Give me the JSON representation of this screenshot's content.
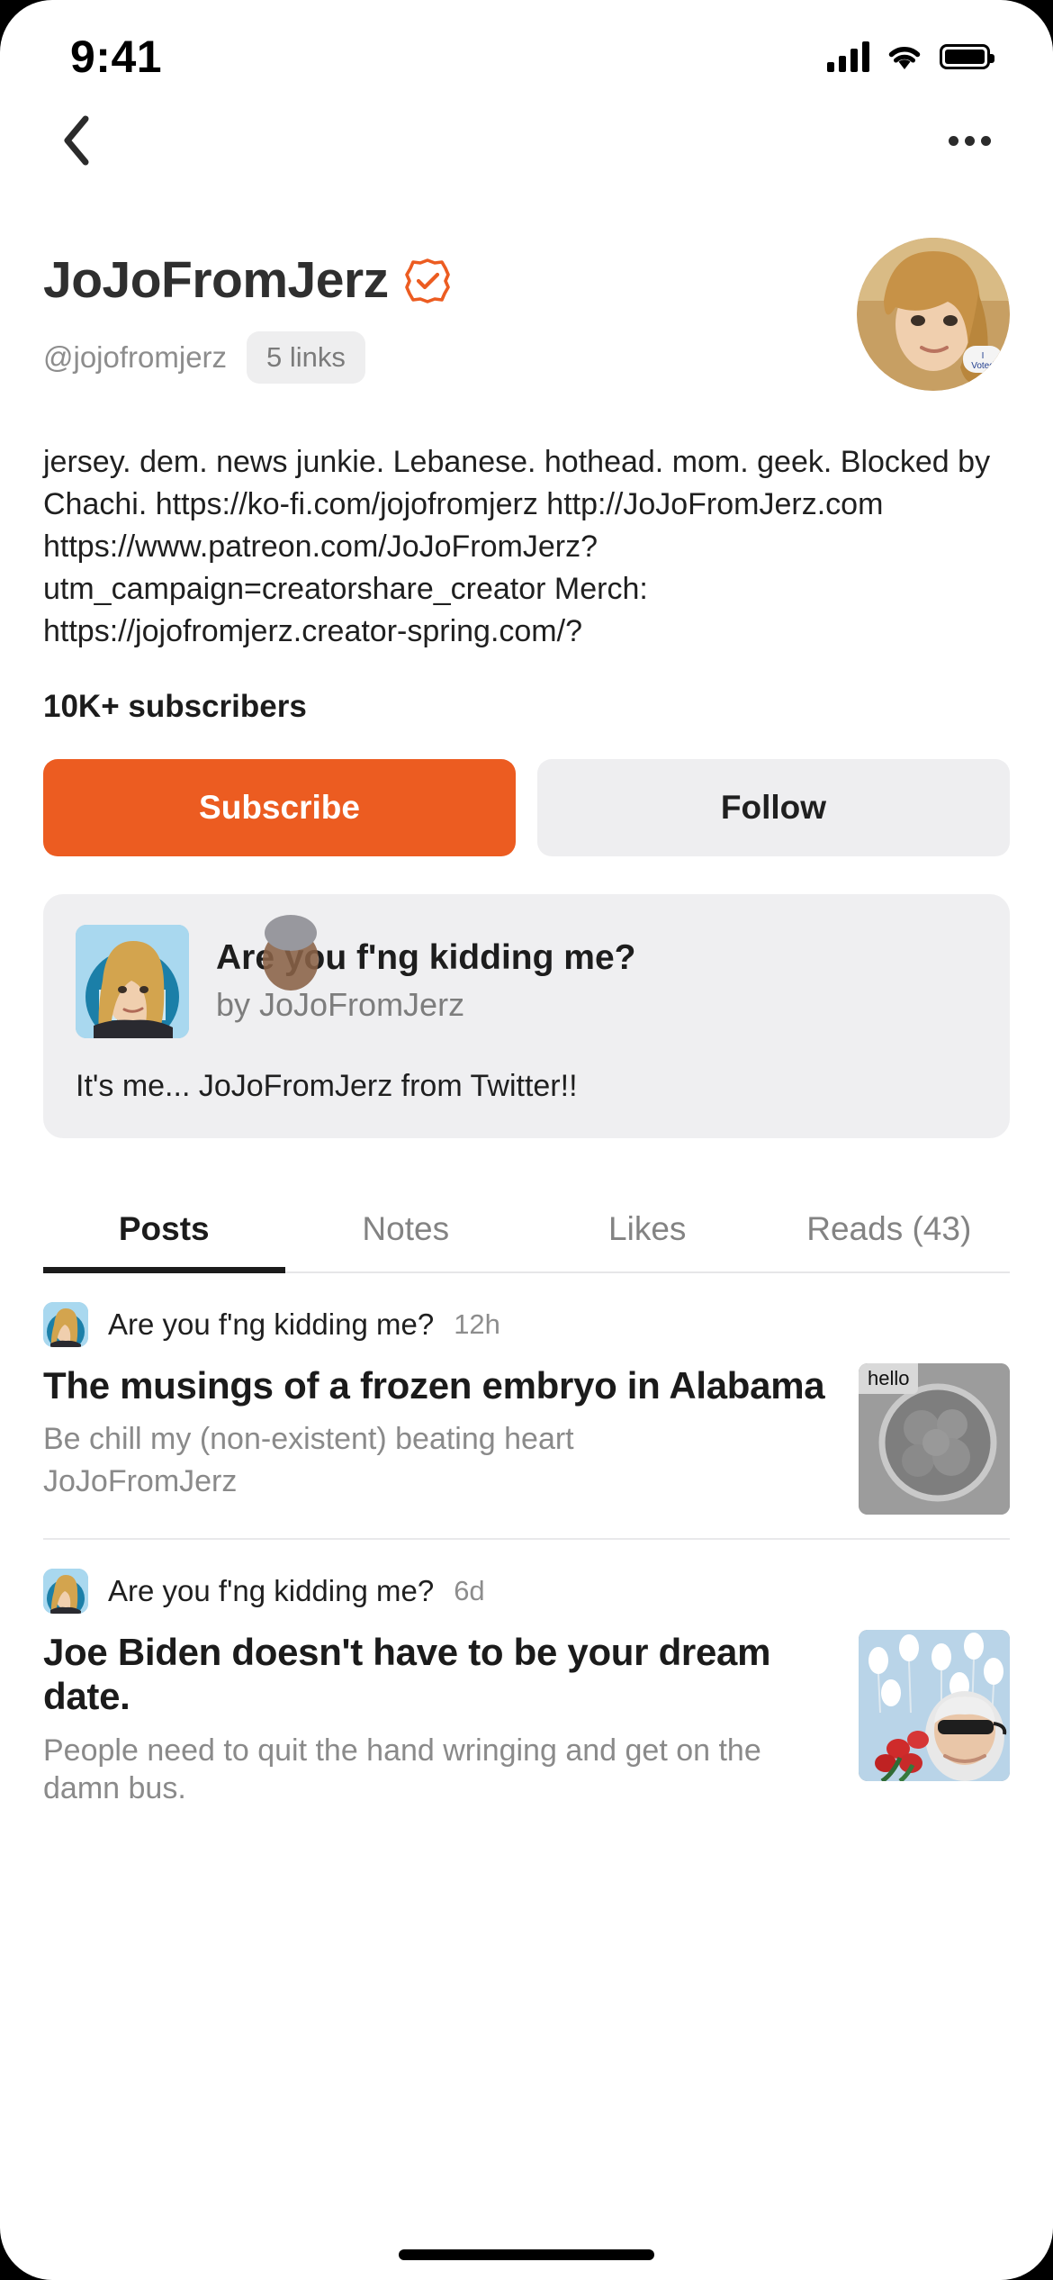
{
  "status_bar": {
    "time": "9:41",
    "signal_icon": "cellular-bars-icon",
    "wifi_icon": "wifi-icon",
    "battery_icon": "battery-full-icon"
  },
  "nav": {
    "back_icon": "chevron-left-icon",
    "more_icon": "ellipsis-horizontal-icon"
  },
  "profile": {
    "name": "JoJoFromJerz",
    "verified_icon": "verified-badge-icon",
    "handle": "@jojofromjerz",
    "links_badge": "5 links",
    "avatar_icon": "profile-avatar",
    "bio": "jersey. dem. news junkie. Lebanese. hothead. mom. geek. Blocked by Chachi. https://ko-fi.com/jojofromjerz http://JoJoFromJerz.com https://www.patreon.com/JoJoFromJerz?utm_campaign=creatorshare_creator Merch: https://jojofromjerz.creator-spring.com/?",
    "subscribers": "10K+ subscribers",
    "subscribe_label": "Subscribe",
    "follow_label": "Follow"
  },
  "publication_card": {
    "thumb_icon": "publication-thumbnail",
    "title": "Are you f'ng kidding me?",
    "byline": "by JoJoFromJerz",
    "description": "It's me... JoJoFromJerz from Twitter!!"
  },
  "tabs": [
    {
      "label": "Posts",
      "active": true
    },
    {
      "label": "Notes",
      "active": false
    },
    {
      "label": "Likes",
      "active": false
    },
    {
      "label": "Reads (43)",
      "active": false
    }
  ],
  "posts": [
    {
      "publication": "Are you f'ng kidding me?",
      "time": "12h",
      "title": "The musings of a frozen embryo in Alabama",
      "subtitle": "Be chill my (non-existent) beating heart",
      "author": "JoJoFromJerz",
      "image_icon": "post-thumbnail-embryo",
      "image_tag": "hello"
    },
    {
      "publication": "Are you f'ng kidding me?",
      "time": "6d",
      "title": "Joe Biden doesn't have to be your dream date.",
      "subtitle": "People need to quit the hand wringing and get on the damn bus.",
      "author": "",
      "image_icon": "post-thumbnail-biden",
      "image_tag": ""
    }
  ],
  "colors": {
    "accent": "#ec5c21",
    "verified": "#ec5c21",
    "muted": "#8d8d8d",
    "surface": "#efeff1"
  }
}
